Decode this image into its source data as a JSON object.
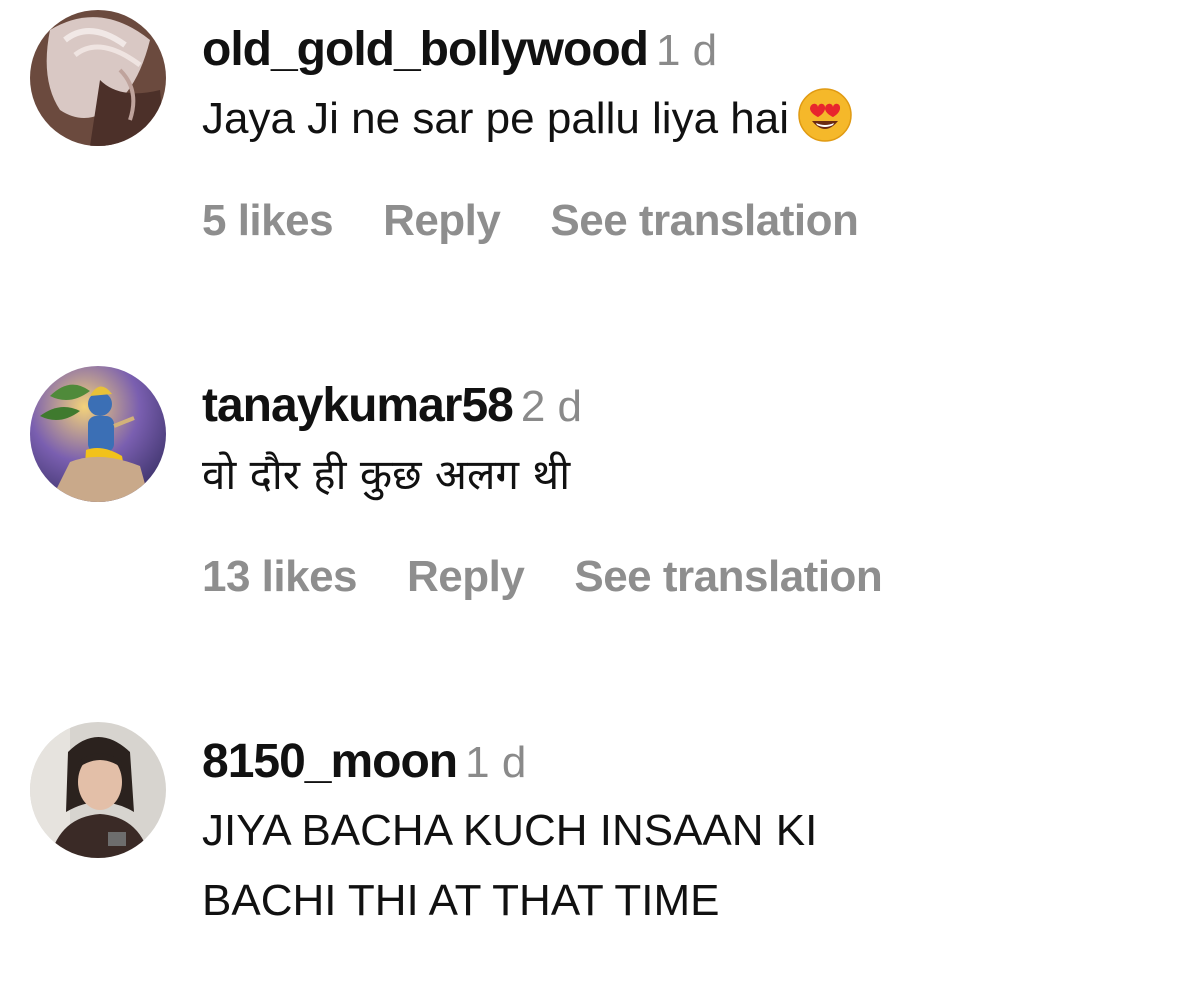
{
  "comments": [
    {
      "username": "old_gold_bollywood",
      "time": "1 d",
      "text": "Jaya Ji ne sar pe pallu liya hai",
      "emoji": "heart-eyes-emoji",
      "likes": "5 likes",
      "reply": "Reply",
      "translate": "See translation"
    },
    {
      "username": "tanaykumar58",
      "time": "2 d",
      "text": "वो दौर ही कुछ अलग थी",
      "likes": "13 likes",
      "reply": "Reply",
      "translate": "See translation"
    },
    {
      "username": "8150_moon",
      "time": "1 d",
      "text_line1": "JIYA BACHA KUCH INSAAN KI",
      "text_line2": "BACHI THI AT THAT TIME"
    }
  ],
  "colors": {
    "username": "#111111",
    "meta": "#8e8e8e",
    "background": "#ffffff"
  }
}
